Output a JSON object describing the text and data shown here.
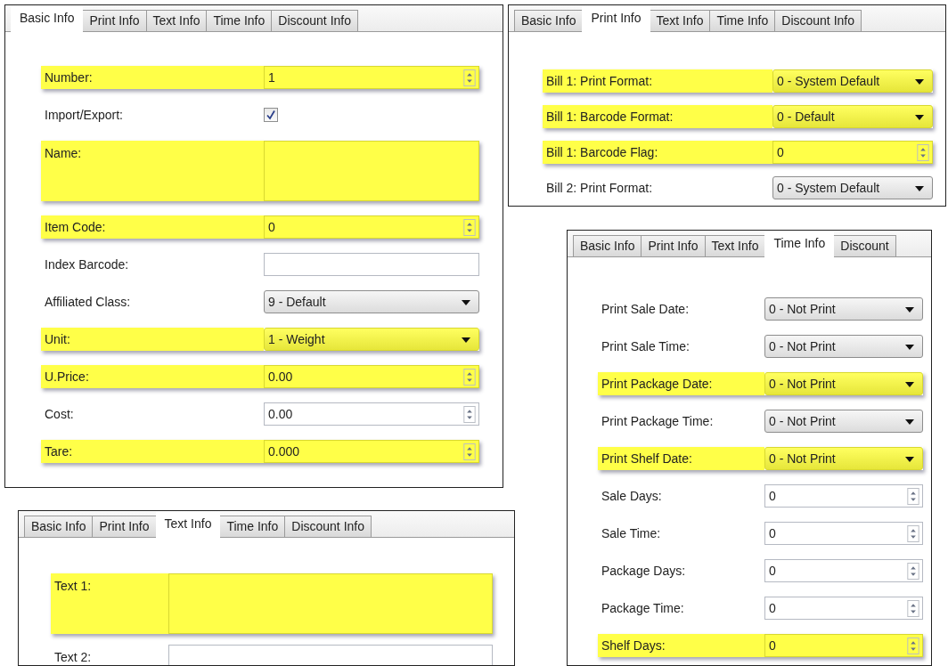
{
  "panels": [
    {
      "tabs": [
        {
          "label": "Basic Info",
          "selected": true
        },
        {
          "label": "Print Info",
          "selected": false
        },
        {
          "label": "Text Info",
          "selected": false
        },
        {
          "label": "Time Info",
          "selected": false
        },
        {
          "label": "Discount Info",
          "selected": false
        }
      ],
      "rows": [
        {
          "label": "Number:",
          "kind": "spin",
          "value": "1",
          "highlighted": true
        },
        {
          "label": "Import/Export:",
          "kind": "check",
          "checked": true,
          "highlighted": false
        },
        {
          "label": "Name:",
          "kind": "memo",
          "value": "",
          "highlighted": true
        },
        {
          "label": "Item Code:",
          "kind": "spin",
          "value": "0",
          "highlighted": true
        },
        {
          "label": "Index Barcode:",
          "kind": "text",
          "value": "",
          "highlighted": false
        },
        {
          "label": "Affiliated Class:",
          "kind": "combo",
          "value": "9 - Default",
          "highlighted": false
        },
        {
          "label": "Unit:",
          "kind": "combo",
          "value": "1 - Weight",
          "highlighted": true
        },
        {
          "label": "U.Price:",
          "kind": "spin",
          "value": "0.00",
          "highlighted": true
        },
        {
          "label": "Cost:",
          "kind": "spin",
          "value": "0.00",
          "highlighted": false
        },
        {
          "label": "Tare:",
          "kind": "spin",
          "value": "0.000",
          "highlighted": true
        }
      ]
    },
    {
      "tabs": [
        {
          "label": "Basic Info",
          "selected": false
        },
        {
          "label": "Print Info",
          "selected": true
        },
        {
          "label": "Text Info",
          "selected": false
        },
        {
          "label": "Time Info",
          "selected": false
        },
        {
          "label": "Discount Info",
          "selected": false
        }
      ],
      "rows": [
        {
          "label": "Bill 1: Print Format:",
          "kind": "combo",
          "value": "0 - System Default",
          "highlighted": true
        },
        {
          "label": "Bill 1: Barcode Format:",
          "kind": "combo",
          "value": "0 - Default",
          "highlighted": true
        },
        {
          "label": "Bill 1: Barcode Flag:",
          "kind": "spin",
          "value": "0",
          "highlighted": true
        },
        {
          "label": "Bill 2: Print Format:",
          "kind": "combo",
          "value": "0 - System Default",
          "highlighted": false
        }
      ]
    },
    {
      "tabs": [
        {
          "label": "Basic Info",
          "selected": false
        },
        {
          "label": "Print Info",
          "selected": false
        },
        {
          "label": "Text Info",
          "selected": false
        },
        {
          "label": "Time Info",
          "selected": true
        },
        {
          "label": "Discount",
          "selected": false
        }
      ],
      "rows": [
        {
          "label": "Print Sale Date:",
          "kind": "combo",
          "value": "0 - Not Print",
          "highlighted": false
        },
        {
          "label": "Print Sale Time:",
          "kind": "combo",
          "value": "0 - Not Print",
          "highlighted": false
        },
        {
          "label": "Print Package Date:",
          "kind": "combo",
          "value": "0 - Not Print",
          "highlighted": true
        },
        {
          "label": "Print Package Time:",
          "kind": "combo",
          "value": "0 - Not Print",
          "highlighted": false
        },
        {
          "label": "Print Shelf Date:",
          "kind": "combo",
          "value": "0 - Not Print",
          "highlighted": true
        },
        {
          "label": "Sale Days:",
          "kind": "spin",
          "value": "0",
          "highlighted": false
        },
        {
          "label": "Sale Time:",
          "kind": "spin",
          "value": "0",
          "highlighted": false
        },
        {
          "label": "Package Days:",
          "kind": "spin",
          "value": "0",
          "highlighted": false
        },
        {
          "label": "Package Time:",
          "kind": "spin",
          "value": "0",
          "highlighted": false
        },
        {
          "label": "Shelf Days:",
          "kind": "spin",
          "value": "0",
          "highlighted": true
        }
      ]
    },
    {
      "tabs": [
        {
          "label": "Basic Info",
          "selected": false
        },
        {
          "label": "Print Info",
          "selected": false
        },
        {
          "label": "Text Info",
          "selected": true
        },
        {
          "label": "Time Info",
          "selected": false
        },
        {
          "label": "Discount Info",
          "selected": false
        }
      ],
      "rows": [
        {
          "label": "Text 1:",
          "kind": "memo",
          "value": "",
          "highlighted": true
        },
        {
          "label": "Text 2:",
          "kind": "memo",
          "value": "",
          "highlighted": false
        }
      ]
    }
  ]
}
